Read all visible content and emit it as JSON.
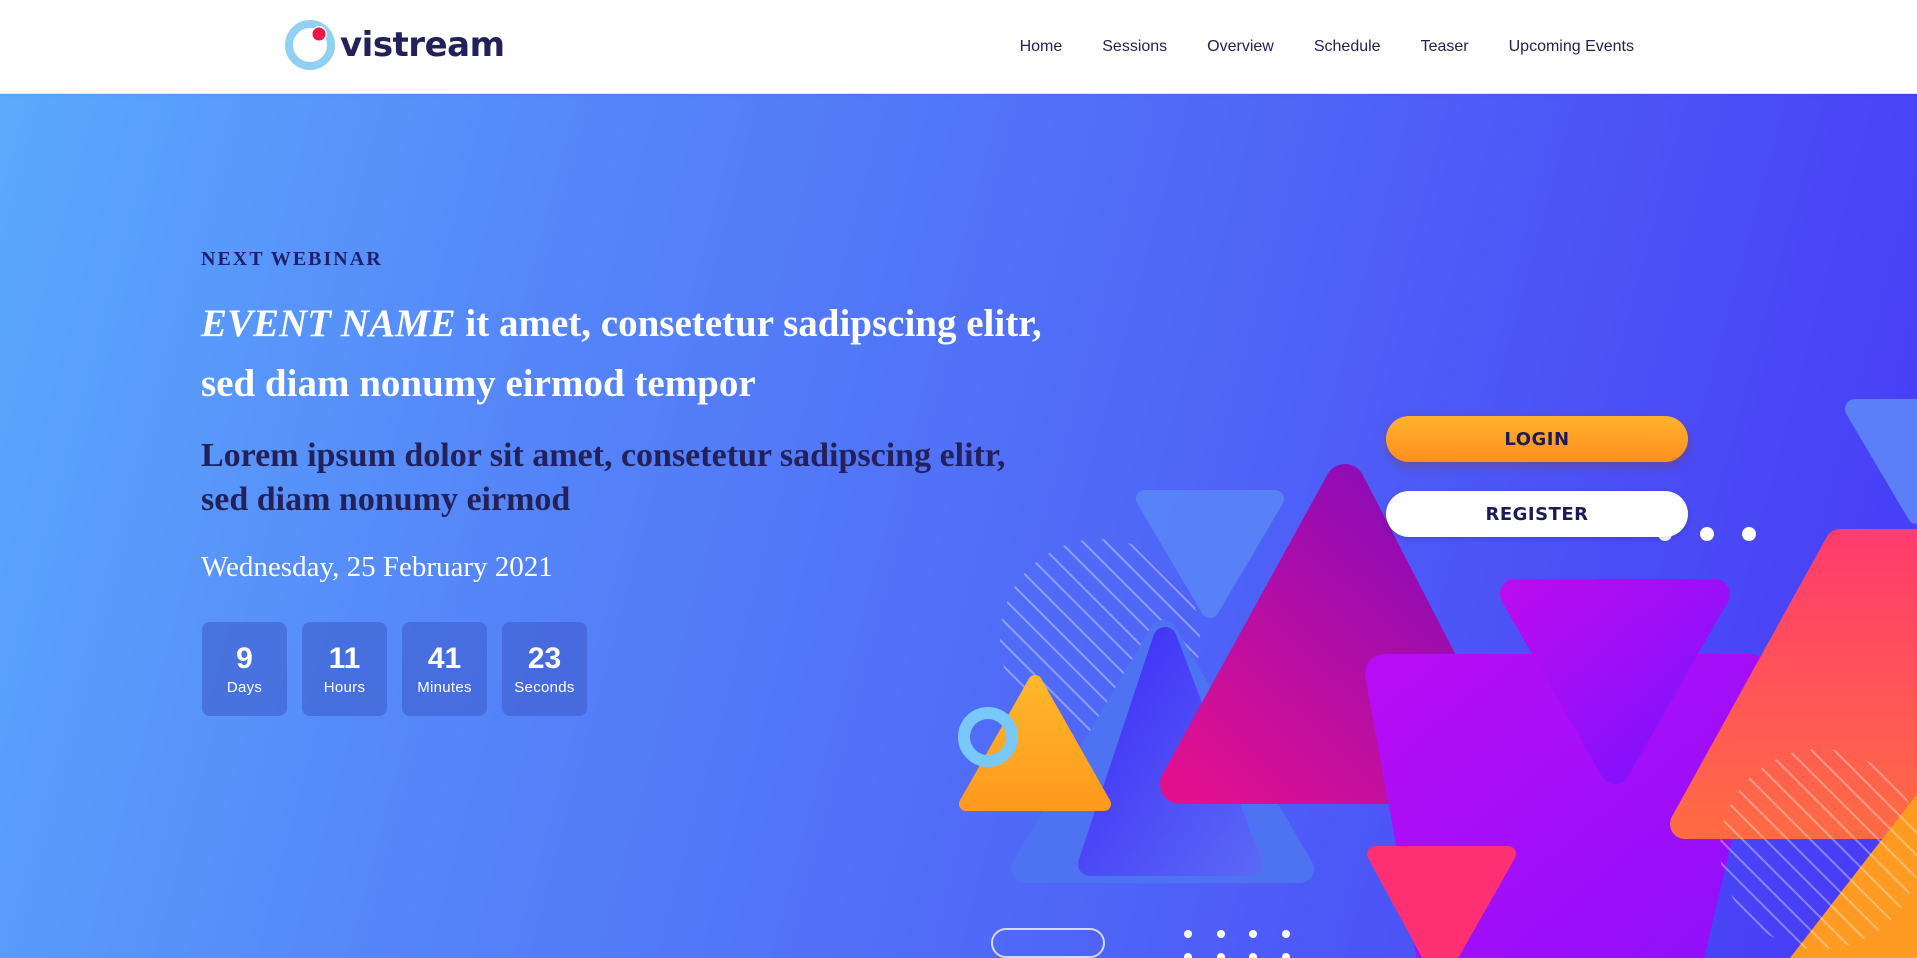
{
  "brand": {
    "name": "vistream"
  },
  "nav": {
    "items": [
      {
        "label": "Home"
      },
      {
        "label": "Sessions"
      },
      {
        "label": "Overview"
      },
      {
        "label": "Schedule"
      },
      {
        "label": "Teaser"
      },
      {
        "label": "Upcoming Events"
      }
    ]
  },
  "hero": {
    "eyebrow": "NEXT WEBINAR",
    "title_em": "EVENT NAME",
    "title_rest": " it amet, consetetur sadipscing elitr, sed diam nonumy eirmod tempor",
    "subtitle": "Lorem ipsum dolor sit amet, consetetur sadipscing elitr, sed diam nonumy eirmod",
    "date": "Wednesday, 25 February 2021",
    "countdown": [
      {
        "value": "9",
        "label": "Days"
      },
      {
        "value": "11",
        "label": "Hours"
      },
      {
        "value": "41",
        "label": "Minutes"
      },
      {
        "value": "23",
        "label": "Seconds"
      }
    ],
    "login_label": "LOGIN",
    "register_label": "REGISTER"
  },
  "colors": {
    "brand_navy": "#23215a",
    "accent_orange": "#ffa125",
    "logo_ring": "#8fd0f3",
    "logo_dot": "#ec1847",
    "hero_gradient_start": "#5ba9fd",
    "hero_gradient_end": "#4738f6"
  },
  "icons": {
    "logo_mark": "ring-with-dot-icon"
  }
}
